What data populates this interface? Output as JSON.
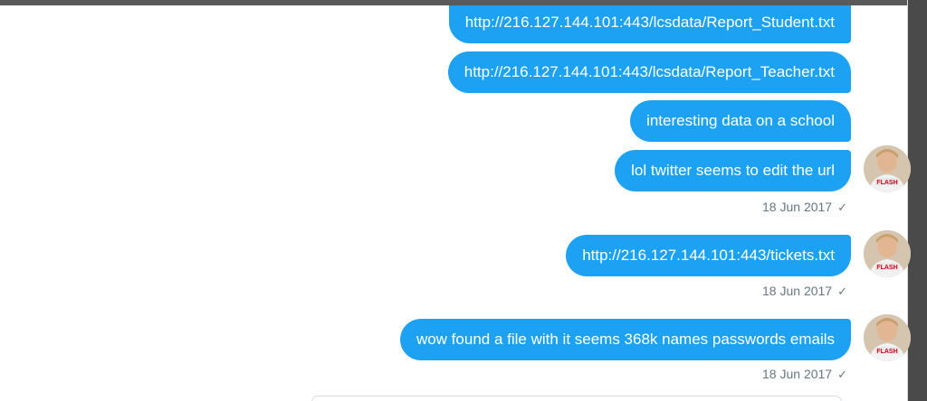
{
  "conversation": {
    "messages": [
      {
        "text": "http://216.127.144.101:443/lcsdata/Report_Student.txt"
      },
      {
        "text": "http://216.127.144.101:443/lcsdata/Report_Teacher.txt"
      },
      {
        "text": "interesting data on a school"
      },
      {
        "text": "lol twitter seems to edit the url"
      },
      {
        "text": "http://216.127.144.101:443/tickets.txt"
      },
      {
        "text": "wow found a file with it seems 368k names passwords emails"
      }
    ],
    "timestamps": [
      "18 Jun 2017",
      "18 Jun 2017",
      "18 Jun 2017"
    ],
    "read_mark": "✓"
  },
  "colors": {
    "bubble": "#1da1f2",
    "bubble_text": "#ffffff",
    "timestamp": "#657786"
  },
  "avatar": {
    "shirt_text": "FLASH"
  }
}
